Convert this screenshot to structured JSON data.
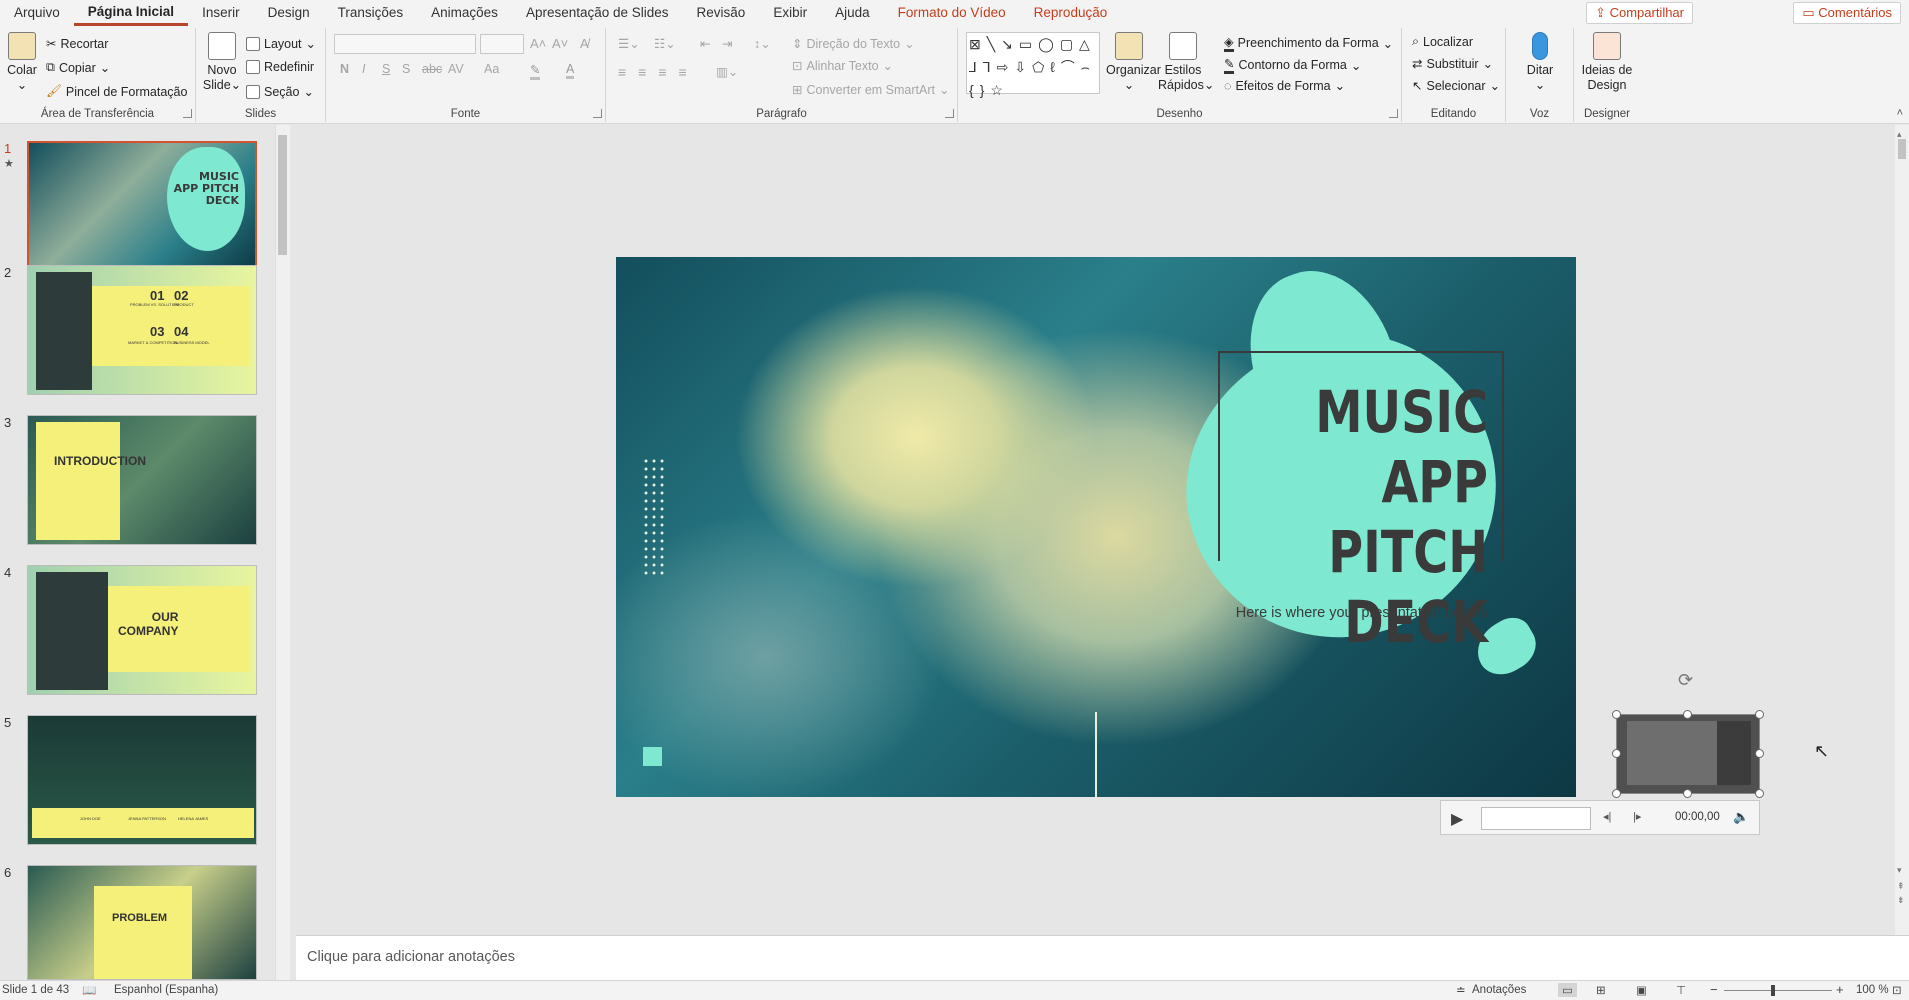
{
  "menu": {
    "tabs": [
      "Arquivo",
      "Página Inicial",
      "Inserir",
      "Design",
      "Transições",
      "Animações",
      "Apresentação de Slides",
      "Revisão",
      "Exibir",
      "Ajuda",
      "Formato do Vídeo",
      "Reprodução"
    ],
    "active_tab": "Página Inicial",
    "share": "Compartilhar",
    "comments": "Comentários"
  },
  "ribbon": {
    "clipboard": {
      "label": "Área de Transferência",
      "paste": "Colar",
      "cut": "Recortar",
      "copy": "Copiar",
      "format_painter": "Pincel de Formatação"
    },
    "slides": {
      "label": "Slides",
      "new_slide_1": "Novo",
      "new_slide_2": "Slide",
      "layout": "Layout",
      "reset": "Redefinir",
      "section": "Seção"
    },
    "font": {
      "label": "Fonte",
      "bold": "N",
      "italic": "I",
      "underline": "S",
      "shadow": "S",
      "strike": "abc",
      "spacing": "AV",
      "case": "Aa"
    },
    "paragraph": {
      "label": "Parágrafo",
      "text_direction": "Direção do Texto",
      "align_text": "Alinhar Texto",
      "smartart": "Converter em SmartArt"
    },
    "drawing": {
      "label": "Desenho",
      "arrange": "Organizar",
      "quick_styles_1": "Estilos",
      "quick_styles_2": "Rápidos",
      "shape_fill": "Preenchimento da Forma",
      "shape_outline": "Contorno da Forma",
      "shape_effects": "Efeitos de Forma"
    },
    "editing": {
      "label": "Editando",
      "find": "Localizar",
      "replace": "Substituir",
      "select": "Selecionar"
    },
    "voice": {
      "label": "Voz",
      "dictate": "Ditar"
    },
    "designer": {
      "label": "Designer",
      "design_ideas_1": "Ideias de",
      "design_ideas_2": "Design"
    }
  },
  "thumbnails": {
    "numbers": [
      "1",
      "2",
      "3",
      "4",
      "5",
      "6"
    ],
    "t2": {
      "n1": "01",
      "n2": "02",
      "n3": "03",
      "n4": "04",
      "l1": "PROBLEM VS. SOLUTION",
      "l2": "PRODUCT",
      "l3": "MARKET & COMPETITION",
      "l4": "BUSINESS MODEL"
    },
    "t3": "INTRODUCTION",
    "t4a": "OUR",
    "t4b": "COMPANY",
    "t5": [
      "JOHN DOE",
      "JENNA PATTERSON",
      "HELENA JAMES"
    ],
    "t6": "PROBLEM"
  },
  "slide": {
    "title_line1": "MUSIC",
    "title_line2": "APP PITCH",
    "title_line3": "DECK",
    "subtitle": "Here is where your presentation begins"
  },
  "video": {
    "time": "00:00,00"
  },
  "notes": {
    "placeholder": "Clique para adicionar anotações"
  },
  "status": {
    "slide_count": "Slide 1 de 43",
    "language": "Espanhol (Espanha)",
    "notes": "Anotações",
    "zoom": "100 %"
  },
  "colors": {
    "accent": "#b7472a",
    "mint": "#7ee8d1",
    "yellow": "#f4f07a",
    "teal_dark": "#134e5c"
  }
}
